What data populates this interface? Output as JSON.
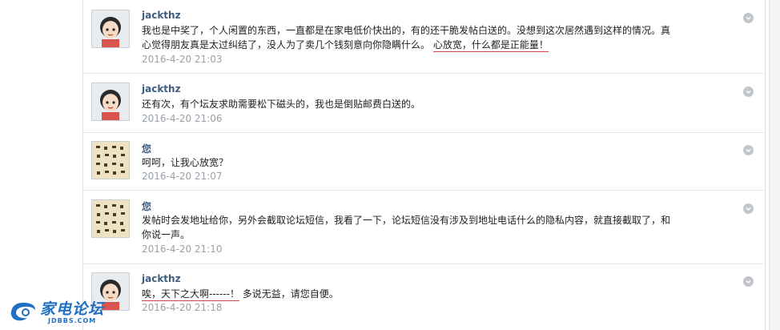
{
  "comments": [
    {
      "author": "jackthz",
      "avatar": "cartoon-girl",
      "text_before": "我也是中奖了，个人闲置的东西，一直都是在家电低价快出的，有的还干脆发帖白送的。没想到这次居然遇到这样的情况。真心觉得朋友真是太过纠结了，没人为了卖几个钱刻意向你隐瞒什么。 ",
      "text_highlight": "心放宽，什么都是正能量！",
      "text_after": "",
      "time": "2016-4-20 21:03"
    },
    {
      "author": "jackthz",
      "avatar": "cartoon-girl",
      "text_before": "还有次，有个坛友求助需要松下磁头的，我也是倒贴邮费白送的。",
      "text_highlight": "",
      "text_after": "",
      "time": "2016-4-20 21:06"
    },
    {
      "author": "您",
      "avatar": "calligraphy",
      "text_before": "呵呵，让我心放宽？",
      "text_highlight": "",
      "text_after": "",
      "time": "2016-4-20 21:07"
    },
    {
      "author": "您",
      "avatar": "calligraphy",
      "text_before": "发帖时会发地址给你，另外会截取论坛短信，我看了一下，论坛短信没有涉及到地址电话什么的隐私内容，就直接截取了，和你说一声。",
      "text_highlight": "",
      "text_after": "",
      "time": "2016-4-20 21:10"
    },
    {
      "author": "jackthz",
      "avatar": "cartoon-girl",
      "text_before": "",
      "text_highlight": "唉，天下之大啊------！",
      "text_after": "  多说无益，请您自便。",
      "time": "2016-4-20 21:18"
    }
  ],
  "watermark": {
    "name": "家电论坛",
    "url": "JDBBS.COM"
  },
  "colors": {
    "author": "#3c5d7f",
    "timestamp": "#9aa1a8",
    "underline": "#d04545",
    "logo": "#1f6fc3"
  }
}
